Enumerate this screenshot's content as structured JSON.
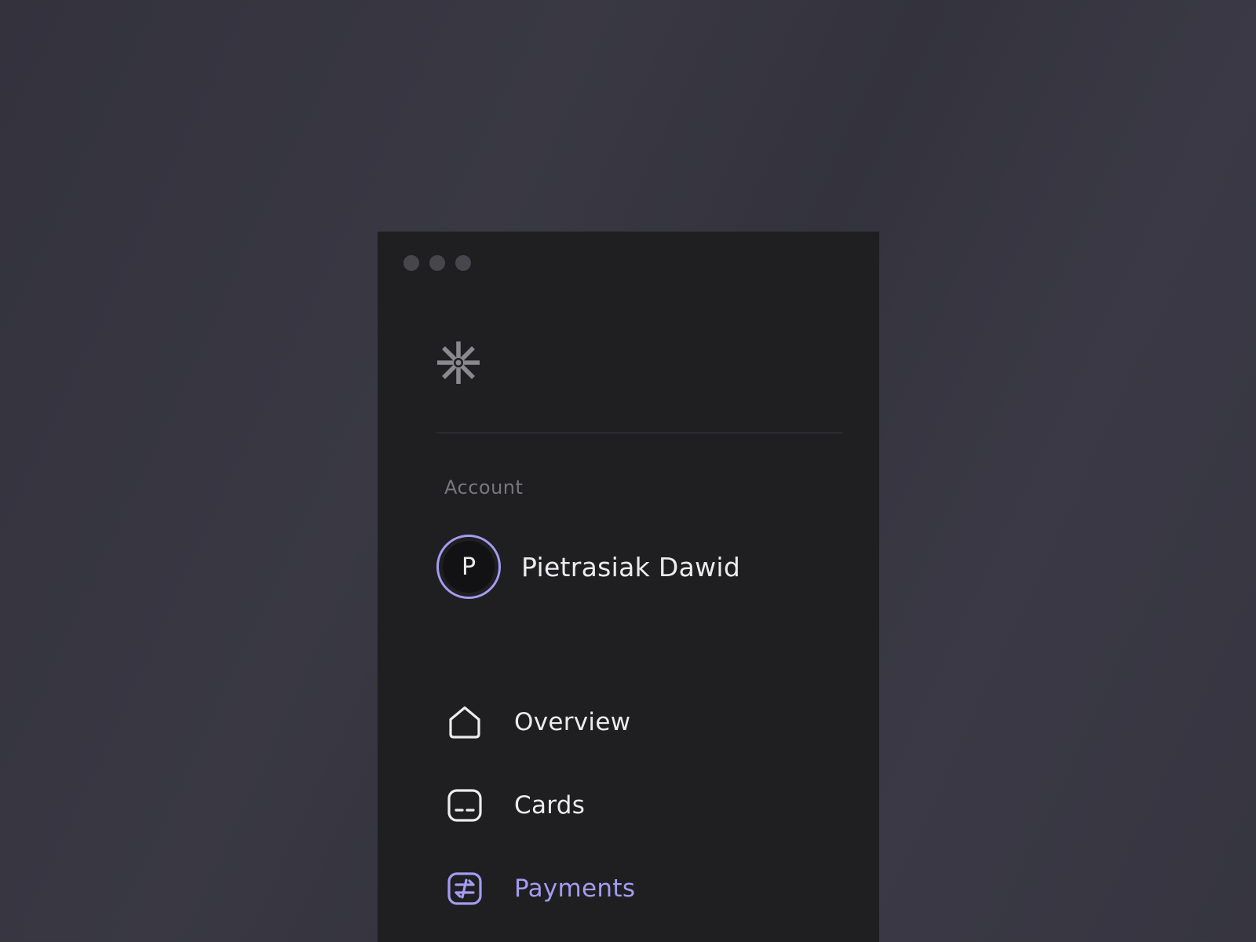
{
  "window": {
    "controls": [
      "window-dot",
      "window-dot",
      "window-dot"
    ]
  },
  "brand": {
    "logo_icon": "asterisk-logo-icon"
  },
  "account": {
    "section_label": "Account",
    "avatar_initial": "P",
    "name": "Pietrasiak Dawid"
  },
  "nav": {
    "items": [
      {
        "label": "Overview",
        "icon": "home-icon",
        "active": false
      },
      {
        "label": "Cards",
        "icon": "card-icon",
        "active": false
      },
      {
        "label": "Payments",
        "icon": "transfer-icon",
        "active": true
      }
    ]
  },
  "colors": {
    "accent": "#a39cf0",
    "panel": "#1f1f22",
    "text": "#ececef",
    "muted": "#77777c"
  }
}
